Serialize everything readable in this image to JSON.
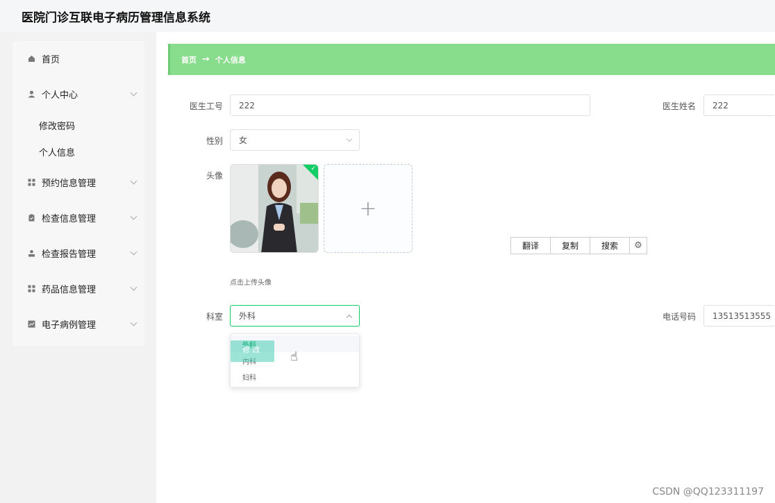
{
  "app": {
    "title": "医院门诊互联电子病历管理信息系统"
  },
  "sidebar": {
    "items": [
      {
        "label": "首页"
      },
      {
        "label": "个人中心",
        "sub": [
          {
            "label": "修改密码"
          },
          {
            "label": "个人信息"
          }
        ]
      },
      {
        "label": "预约信息管理"
      },
      {
        "label": "检查信息管理"
      },
      {
        "label": "检查报告管理"
      },
      {
        "label": "药品信息管理"
      },
      {
        "label": "电子病例管理"
      }
    ]
  },
  "breadcrumb": {
    "home": "首页",
    "sep": "→",
    "current": "个人信息"
  },
  "form": {
    "doctor_id": {
      "label": "医生工号",
      "value": "222"
    },
    "doctor_name": {
      "label": "医生姓名",
      "value": "222"
    },
    "gender": {
      "label": "性别",
      "value": "女"
    },
    "avatar": {
      "label": "头像",
      "upload_hint": "点击上传头像",
      "plus": "+"
    },
    "department": {
      "label": "科室",
      "value": "外科",
      "options": [
        "外科",
        "内科",
        "妇科"
      ]
    },
    "phone": {
      "label": "电话号码",
      "value": "13513513555"
    }
  },
  "context_menu": {
    "translate": "翻译",
    "copy": "复制",
    "search": "搜索",
    "settings": "⚙"
  },
  "overlay": {
    "chip_text": "修 改",
    "cursor": "☝"
  },
  "watermark": "CSDN @QQ123311197",
  "colors": {
    "breadcrumb_bg": "#88dd8c",
    "accent_green": "#13ce66",
    "selected_text": "#13a85a"
  }
}
